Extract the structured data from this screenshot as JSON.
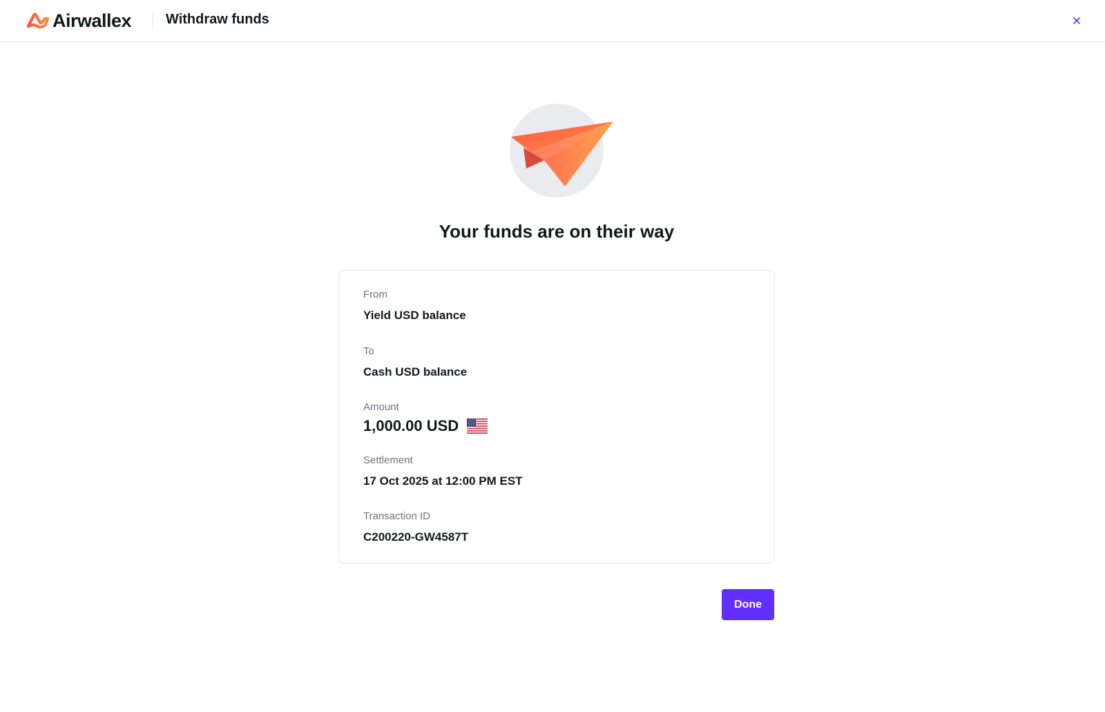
{
  "brand": {
    "name": "Airwallex",
    "accent": "#612fff",
    "logo_colors": [
      "#ff4f42",
      "#ff8e3c"
    ]
  },
  "header": {
    "title": "Withdraw funds",
    "close_icon": "close-icon"
  },
  "hero": {
    "icon": "paper-plane-icon"
  },
  "confirmation": {
    "headline": "Your funds are on their way",
    "from_label": "From",
    "from_value": "Yield USD balance",
    "to_label": "To",
    "to_value": "Cash USD balance",
    "amount_label": "Amount",
    "amount_value": "1,000.00 USD",
    "amount_flag_icon": "us-flag-icon",
    "settlement_label": "Settlement",
    "settlement_value": "17 Oct 2025 at 12:00 PM EST",
    "transaction_label": "Transaction ID",
    "transaction_value": "C200220-GW4587T"
  },
  "actions": {
    "done_label": "Done"
  }
}
